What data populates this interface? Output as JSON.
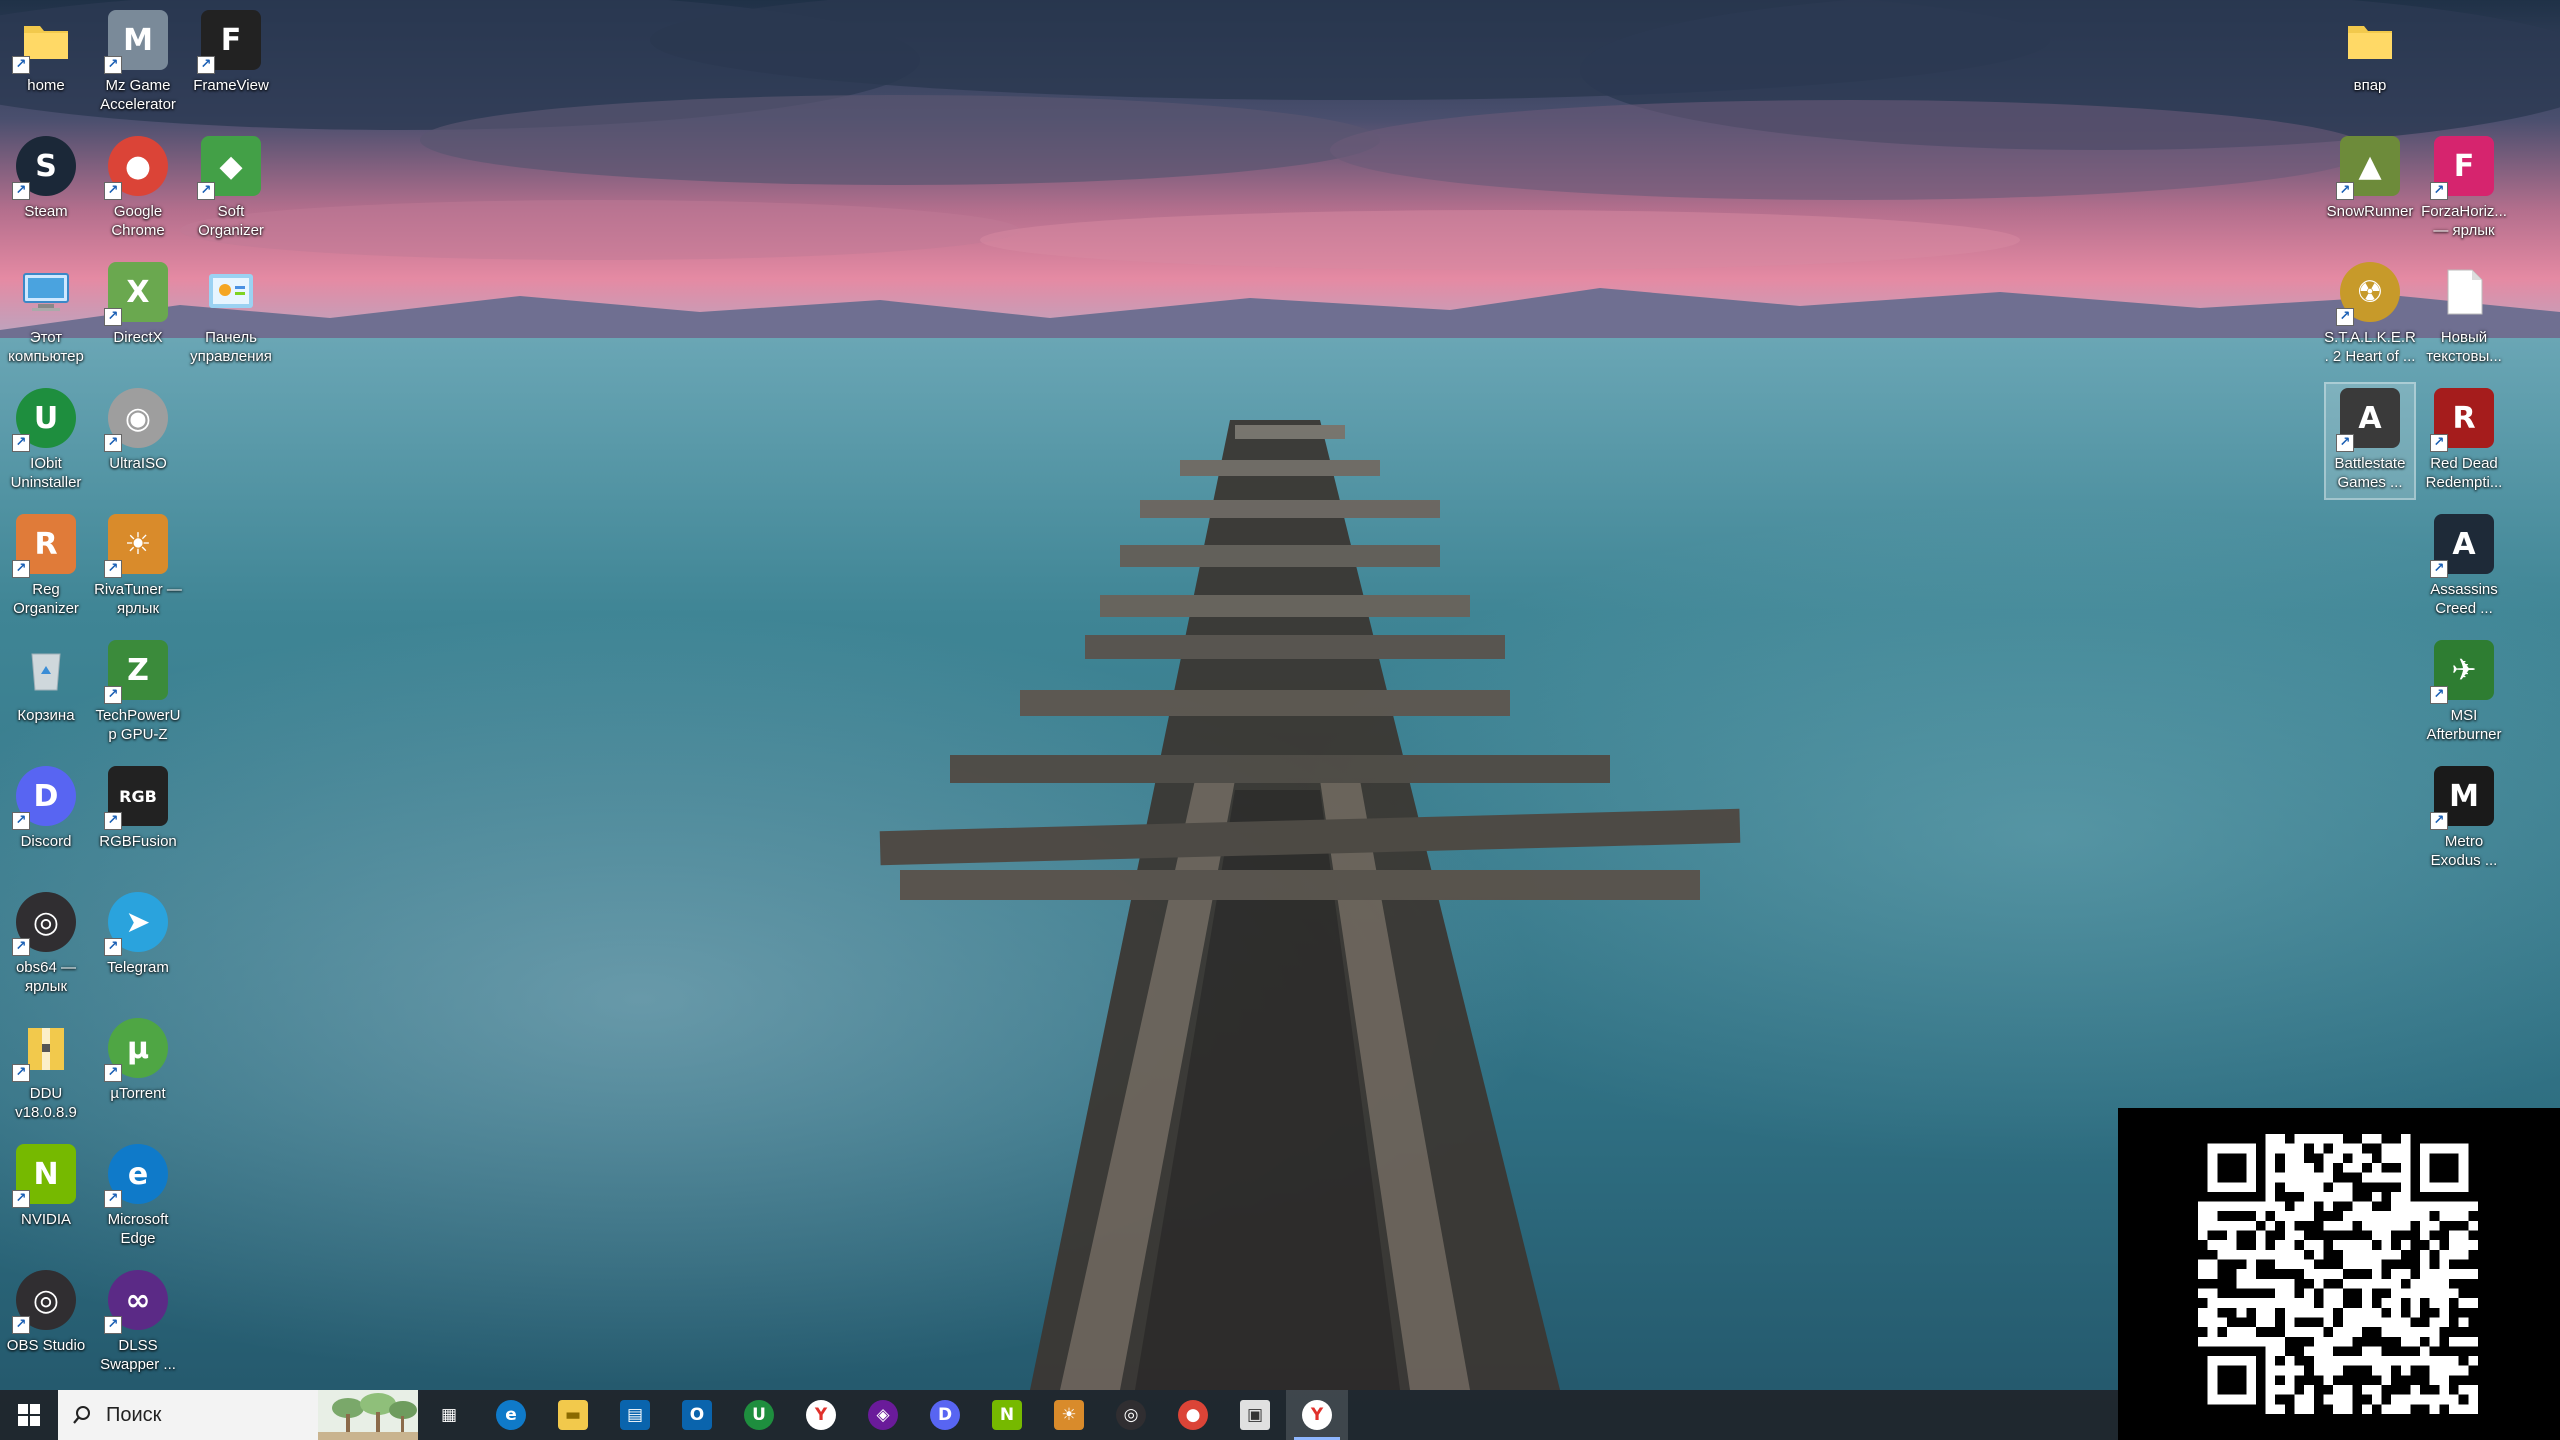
{
  "desktop": {
    "icons_left_col1": [
      {
        "label": "home",
        "icon": "folder-icon",
        "color": "#f2c94c"
      },
      {
        "label": "Steam",
        "icon": "steam-icon",
        "color": "#1b2838"
      },
      {
        "label": "Этот компьютер",
        "icon": "computer-icon",
        "color": "#4aa3df"
      },
      {
        "label": "IObit Uninstaller",
        "icon": "iobit-uninstaller-icon",
        "color": "#1e8e3e"
      },
      {
        "label": "Reg Organizer",
        "icon": "reg-organizer-icon",
        "color": "#e07b39"
      },
      {
        "label": "Корзина",
        "icon": "recycle-bin-icon",
        "color": "#cfd8dc"
      },
      {
        "label": "Discord",
        "icon": "discord-icon",
        "color": "#5865f2"
      },
      {
        "label": "obs64 — ярлык",
        "icon": "obs-icon",
        "color": "#302e31"
      },
      {
        "label": "DDU v18.0.8.9",
        "icon": "archive-folder-icon",
        "color": "#f2c94c"
      },
      {
        "label": "NVIDIA",
        "icon": "nvidia-icon",
        "color": "#76b900"
      },
      {
        "label": "OBS Studio",
        "icon": "obs-studio-icon",
        "color": "#302e31"
      }
    ],
    "icons_left_col2": [
      {
        "label": "Mz Game Accelerator",
        "icon": "mz-game-accelerator-icon",
        "color": "#7a8a99"
      },
      {
        "label": "Google Chrome",
        "icon": "chrome-icon",
        "color": "#db4437"
      },
      {
        "label": "DirectX",
        "icon": "directx-icon",
        "color": "#6aa84f"
      },
      {
        "label": "UltraISO",
        "icon": "ultraiso-icon",
        "color": "#9e9e9e"
      },
      {
        "label": "RivaTuner — ярлык",
        "icon": "rivatuner-icon",
        "color": "#d98b2b"
      },
      {
        "label": "TechPowerUp GPU-Z",
        "icon": "gpuz-icon",
        "color": "#3b8b3b"
      },
      {
        "label": "RGBFusion",
        "icon": "rgbfusion-icon",
        "color": "#222222"
      },
      {
        "label": "Telegram",
        "icon": "telegram-icon",
        "color": "#2aa3dd"
      },
      {
        "label": "µTorrent",
        "icon": "utorrent-icon",
        "color": "#4fa644"
      },
      {
        "label": "Microsoft Edge",
        "icon": "edge-icon",
        "color": "#0f7ac9"
      },
      {
        "label": "DLSS Swapper ...",
        "icon": "dlss-swapper-icon",
        "color": "#5b2a86"
      }
    ],
    "icons_left_col3": [
      {
        "label": "FrameView",
        "icon": "frameview-icon",
        "color": "#222222"
      },
      {
        "label": "Soft Organizer",
        "icon": "soft-organizer-icon",
        "color": "#43a047"
      },
      {
        "label": "Панель управления",
        "icon": "control-panel-icon",
        "color": "#4aa3df"
      }
    ],
    "icons_right_col1": [
      {
        "label": "впар",
        "icon": "folder-icon",
        "color": "#f2c94c"
      },
      {
        "label": "SnowRunner",
        "icon": "snowrunner-icon",
        "color": "#6d8b3a"
      },
      {
        "label": "S.T.A.L.K.E.R. 2 Heart of ...",
        "icon": "stalker-icon",
        "color": "#c79a2a"
      },
      {
        "label": "Battlestate Games ...",
        "icon": "battlestate-icon",
        "color": "#3a3a3a"
      }
    ],
    "icons_right_col2": [
      {
        "label": "ForzaHoriz... — ярлык",
        "icon": "forza-horizon-icon",
        "color": "#d6246e"
      },
      {
        "label": "Новый текстовы...",
        "icon": "text-document-icon",
        "color": "#ffffff"
      },
      {
        "label": "Red Dead Redempti...",
        "icon": "red-dead-icon",
        "color": "#a51c1c"
      },
      {
        "label": "Assassins Creed ...",
        "icon": "assassins-creed-icon",
        "color": "#1e2a38"
      },
      {
        "label": "MSI Afterburner",
        "icon": "msi-afterburner-icon",
        "color": "#2e7d32"
      },
      {
        "label": "Metro Exodus ...",
        "icon": "metro-exodus-icon",
        "color": "#1a1a1a"
      }
    ]
  },
  "taskbar": {
    "search_placeholder": "Поиск",
    "items": [
      {
        "name": "task-view",
        "icon": "task-view-icon",
        "color": "#ffffff",
        "active": false
      },
      {
        "name": "edge",
        "icon": "edge-icon",
        "color": "#0f7ac9",
        "active": false
      },
      {
        "name": "file-explorer",
        "icon": "folder-icon",
        "color": "#f2c94c",
        "active": false
      },
      {
        "name": "microsoft-store",
        "icon": "store-icon",
        "color": "#0a64ad",
        "active": false
      },
      {
        "name": "outlook",
        "icon": "outlook-icon",
        "color": "#0a64ad",
        "active": false
      },
      {
        "name": "iobit-uninstaller",
        "icon": "iobit-uninstaller-icon",
        "color": "#1e8e3e",
        "active": false
      },
      {
        "name": "yandex-browser",
        "icon": "yandex-browser-icon",
        "color": "#ffffff",
        "active": false
      },
      {
        "name": "app-purple",
        "icon": "purple-app-icon",
        "color": "#6a1b9a",
        "active": false
      },
      {
        "name": "discord",
        "icon": "discord-icon",
        "color": "#5865f2",
        "active": false
      },
      {
        "name": "nvidia",
        "icon": "nvidia-icon",
        "color": "#76b900",
        "active": false
      },
      {
        "name": "rivatuner",
        "icon": "rivatuner-icon",
        "color": "#d98b2b",
        "active": false
      },
      {
        "name": "obs",
        "icon": "obs-icon",
        "color": "#302e31",
        "active": false
      },
      {
        "name": "chrome",
        "icon": "chrome-icon",
        "color": "#db4437",
        "active": false
      },
      {
        "name": "window-app",
        "icon": "window-app-icon",
        "color": "#e0e0e0",
        "active": false
      },
      {
        "name": "yandex-browser-2",
        "icon": "yandex-browser-icon",
        "color": "#ffffff",
        "active": true
      }
    ]
  },
  "colors": {
    "sky_top": "#1f3147",
    "sky_glow": "#e58aa3",
    "water": "#3f8595",
    "taskbar_bg": "#20242a",
    "accent": "#8fb7ff"
  }
}
